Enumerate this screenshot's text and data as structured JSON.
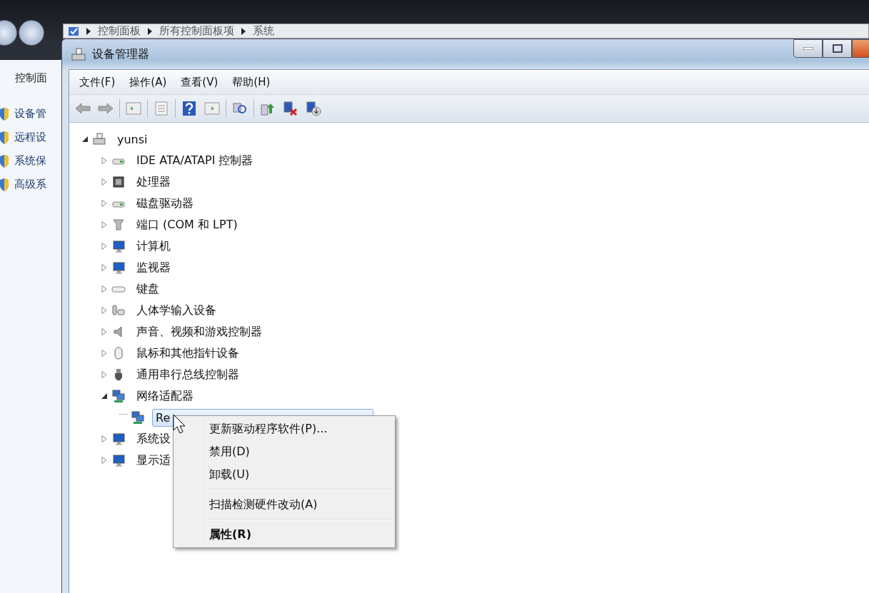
{
  "desktop_window": {
    "breadcrumb": [
      "控制面板",
      "所有控制面板项",
      "系统"
    ],
    "pane_title": "控制面",
    "tasks": [
      "设备管",
      "远程设",
      "系统保",
      "高级系"
    ]
  },
  "window": {
    "title": "设备管理器"
  },
  "menu_bar": [
    "文件(F)",
    "操作(A)",
    "查看(V)",
    "帮助(H)"
  ],
  "tree": {
    "label": "yunsi",
    "expanded": true,
    "selected": false,
    "children": [
      {
        "label": "IDE ATA/ATAPI 控制器",
        "expanded": false,
        "selected": false
      },
      {
        "label": "处理器",
        "expanded": false,
        "selected": false
      },
      {
        "label": "磁盘驱动器",
        "expanded": false,
        "selected": false
      },
      {
        "label": "端口 (COM 和 LPT)",
        "expanded": false,
        "selected": false
      },
      {
        "label": "计算机",
        "expanded": false,
        "selected": false
      },
      {
        "label": "监视器",
        "expanded": false,
        "selected": false
      },
      {
        "label": "键盘",
        "expanded": false,
        "selected": false
      },
      {
        "label": "人体学输入设备",
        "expanded": false,
        "selected": false
      },
      {
        "label": "声音、视频和游戏控制器",
        "expanded": false,
        "selected": false
      },
      {
        "label": "鼠标和其他指针设备",
        "expanded": false,
        "selected": false
      },
      {
        "label": "通用串行总线控制器",
        "expanded": false,
        "selected": false
      },
      {
        "label": "网络适配器",
        "expanded": true,
        "selected": false,
        "children": [
          {
            "label": "Re",
            "selected": true
          }
        ]
      },
      {
        "label": "系统设",
        "expanded": false,
        "selected": false
      },
      {
        "label": "显示适",
        "expanded": false,
        "selected": false
      }
    ]
  },
  "context_menu": {
    "groups": [
      [
        {
          "label": "更新驱动程序软件(P)...",
          "default": false
        },
        {
          "label": "禁用(D)",
          "default": false
        },
        {
          "label": "卸载(U)",
          "default": false
        }
      ],
      [
        {
          "label": "扫描检测硬件改动(A)",
          "default": false
        }
      ],
      [
        {
          "label": "属性(R)",
          "default": true
        }
      ]
    ]
  }
}
